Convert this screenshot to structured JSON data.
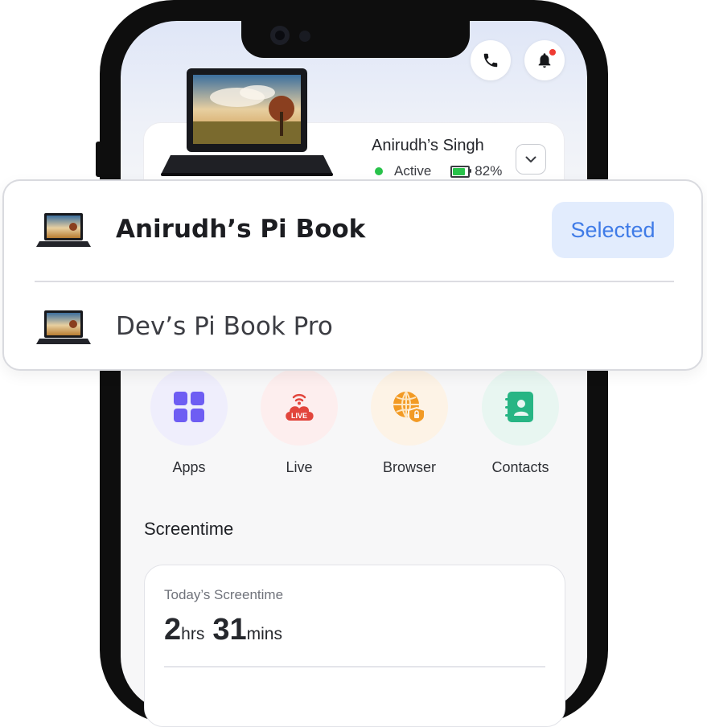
{
  "header": {
    "call_icon": "phone-icon",
    "notification_icon": "bell-icon",
    "notification_dot_color": "#ef3b33"
  },
  "device_card": {
    "owner_name": "Anirudh’s Singh",
    "status_text": "Active",
    "status_color": "#28c24a",
    "battery_percent": 82,
    "battery_text": "82%"
  },
  "device_dropdown": {
    "items": [
      {
        "name": "Anirudh’s Pi Book",
        "selected_label": "Selected",
        "selected": true
      },
      {
        "name": "Dev’s Pi Book Pro",
        "selected": false
      }
    ],
    "accent_color": "#3f7be7"
  },
  "quick_actions": [
    {
      "label": "Apps",
      "icon": "apps-grid-icon",
      "bg": "#efeefc"
    },
    {
      "label": "Live",
      "icon": "live-cloud-icon",
      "bg": "#fdeeee"
    },
    {
      "label": "Browser",
      "icon": "globe-shield-icon",
      "bg": "#fdf3e6"
    },
    {
      "label": "Contacts",
      "icon": "contacts-book-icon",
      "bg": "#e8f6f1"
    }
  ],
  "screentime": {
    "section_title": "Screentime",
    "caption": "Today’s Screentime",
    "hours": "2",
    "hours_unit": "hrs",
    "minutes": "31",
    "minutes_unit": "mins"
  }
}
